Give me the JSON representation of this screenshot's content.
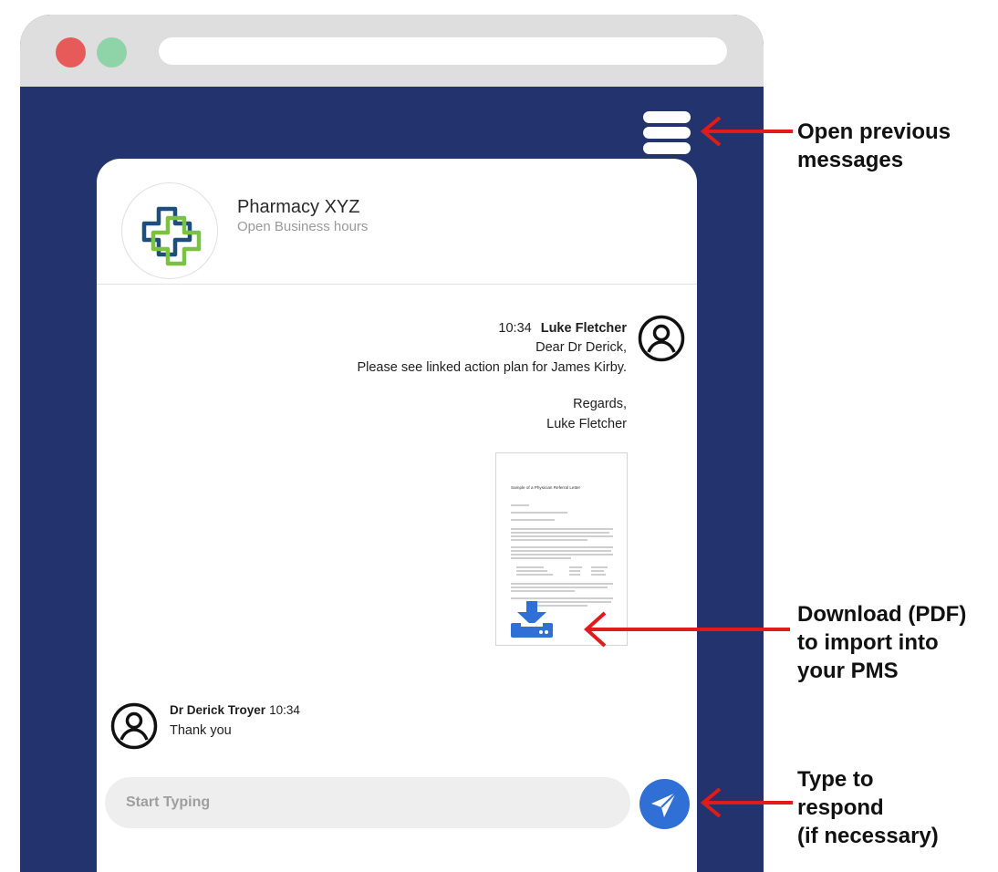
{
  "chat": {
    "pharmacy_name": "Pharmacy XYZ",
    "pharmacy_status": "Open Business hours"
  },
  "outgoing_message": {
    "time": "10:34",
    "sender": "Luke Fletcher",
    "lines": [
      "Dear Dr Derick,",
      "Please see linked action plan for James Kirby."
    ],
    "signoff": [
      "Regards,",
      "Luke Fletcher"
    ],
    "attachment_title": "Sample of a Physician Referral Letter"
  },
  "incoming_message": {
    "sender": "Dr Derick Troyer",
    "time": "10:34",
    "text": "Thank you"
  },
  "composer": {
    "placeholder": "Start Typing"
  },
  "annotations": {
    "menu": [
      "Open previous",
      "messages"
    ],
    "download": [
      "Download (PDF)",
      "to import into",
      "your PMS"
    ],
    "respond": [
      "Type to",
      "respond",
      "(if necessary)"
    ]
  },
  "colors": {
    "frame": "#22336e",
    "annotation_arrow": "#e01b1b",
    "send_button": "#2f6fd6",
    "download_icon": "#2f6fd6"
  },
  "icons": {
    "menu": "stack-menu-icon",
    "avatar": "user-circle-icon",
    "download": "download-icon",
    "send": "paper-plane-icon",
    "logo": "pharmacy-cross-logo"
  }
}
